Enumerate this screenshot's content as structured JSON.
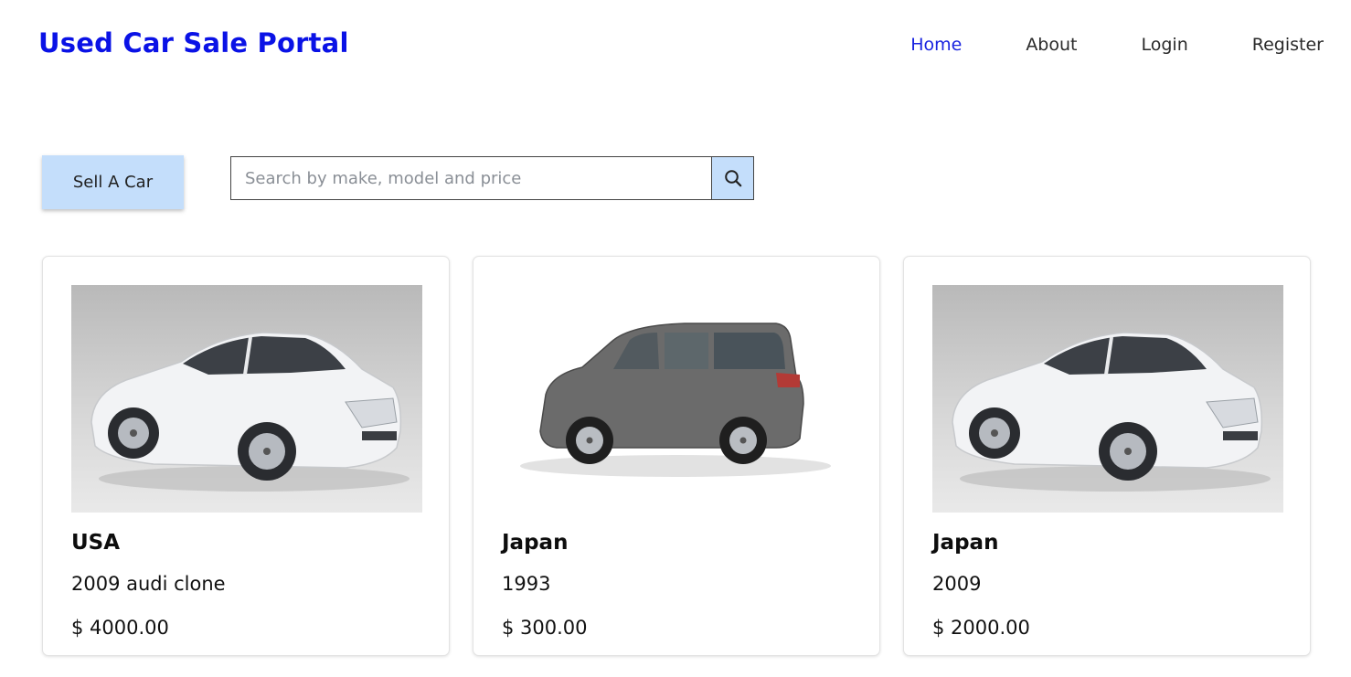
{
  "header": {
    "brand": "Used Car Sale Portal",
    "nav": [
      {
        "label": "Home",
        "active": true
      },
      {
        "label": "About",
        "active": false
      },
      {
        "label": "Login",
        "active": false
      },
      {
        "label": "Register",
        "active": false
      }
    ]
  },
  "toolbar": {
    "sell_label": "Sell A Car",
    "search_placeholder": "Search by make, model and price",
    "search_value": "",
    "search_icon": "search-icon"
  },
  "colors": {
    "brand": "#0a12e6",
    "nav_active": "#1a24e0",
    "button_bg": "#c4defb"
  },
  "cars": [
    {
      "country": "USA",
      "description": "2009 audi clone",
      "price": "$ 4000.00",
      "image": "white-sedan"
    },
    {
      "country": "Japan",
      "description": "1993",
      "price": "$ 300.00",
      "image": "grey-minivan"
    },
    {
      "country": "Japan",
      "description": "2009",
      "price": "$ 2000.00",
      "image": "white-sedan"
    }
  ]
}
